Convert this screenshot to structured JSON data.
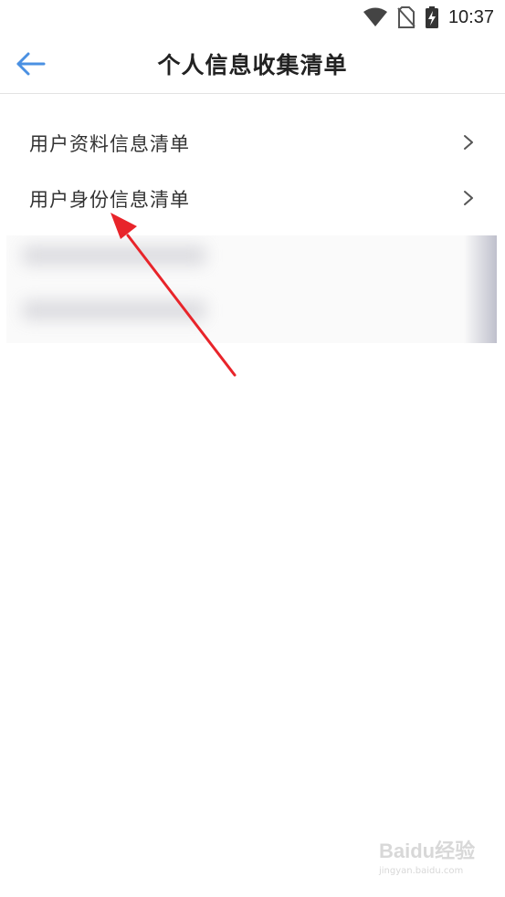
{
  "status_bar": {
    "time": "10:37",
    "icons": [
      "wifi-icon",
      "no-sim-icon",
      "battery-charging-icon"
    ]
  },
  "header": {
    "title": "个人信息收集清单",
    "back_icon": "arrow-left-icon",
    "accent_color": "#4a90e2"
  },
  "list": {
    "items": [
      {
        "label": "用户资料信息清单",
        "icon": "chevron-right-icon"
      },
      {
        "label": "用户身份信息清单",
        "icon": "chevron-right-icon"
      }
    ]
  },
  "annotation": {
    "color": "#e8242a",
    "icon": "red-arrow-annotation"
  },
  "watermark": {
    "brand": "Baidu经验",
    "sub": "jingyan.baidu.com"
  }
}
